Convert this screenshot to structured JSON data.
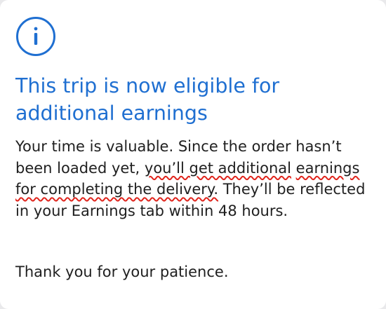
{
  "dialog": {
    "icon": "info-circle-icon",
    "title": "This trip is now eligible for additional earnings",
    "body_before": "Your time is valuable. Since the order hasn’t been loaded yet, ",
    "body_highlight_1": "you’ll get additional",
    "body_highlight_2": "earnings for completing the delivery.",
    "body_after": " They’ll be reflected in your Earnings tab within 48 hours.",
    "thanks": "Thank you for your patience."
  },
  "colors": {
    "accent": "#1f6fd1",
    "text": "#1f1f1f",
    "annotation": "#e0241c",
    "background": "#ffffff"
  }
}
